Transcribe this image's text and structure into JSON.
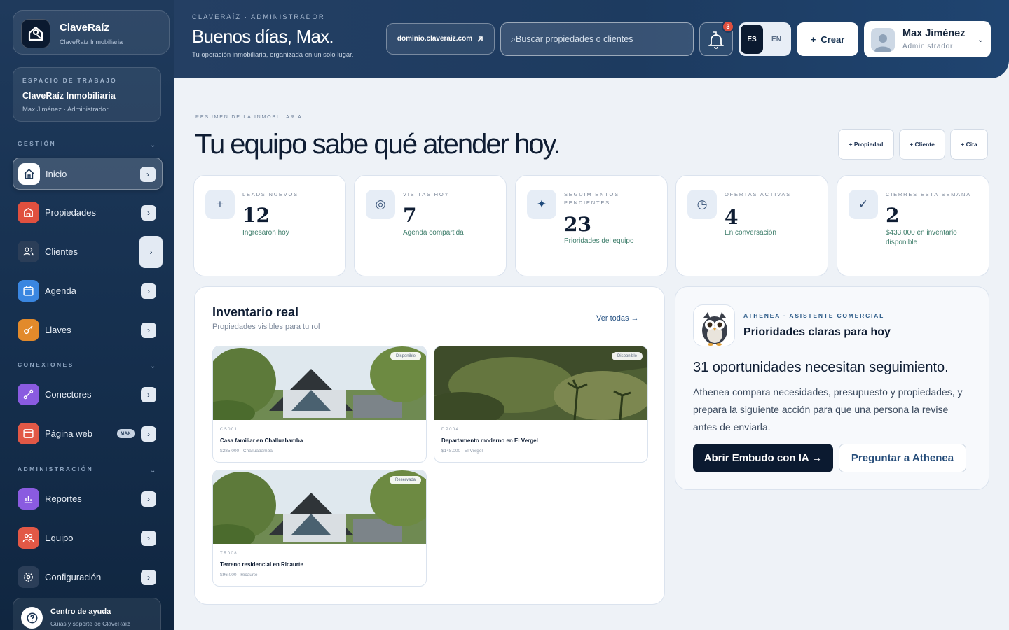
{
  "brand": {
    "name": "ClaveRaíz",
    "sub": "ClaveRaíz Inmobiliaria"
  },
  "workspace": {
    "label": "ESPACIO DE TRABAJO",
    "name": "ClaveRaíz Inmobiliaria",
    "user": "Max Jiménez · Administrador"
  },
  "sidebar": {
    "sections": [
      {
        "title": "GESTIÓN",
        "chevron": "⌄"
      },
      {
        "title": "CONEXIONES",
        "chevron": "⌄"
      },
      {
        "title": "ADMINISTRACIÓN",
        "chevron": "⌄"
      }
    ],
    "items": [
      {
        "label": "Inicio",
        "icon": "home-icon",
        "color": "#ffffff",
        "arrow": "›"
      },
      {
        "label": "Propiedades",
        "icon": "building-icon",
        "color": "#e0503f",
        "arrow": "›"
      },
      {
        "label": "Clientes",
        "icon": "users-icon",
        "color": "#2b3e58",
        "arrow": "›"
      },
      {
        "label": "Agenda",
        "icon": "calendar-icon",
        "color": "#3a86e0",
        "arrow": "›"
      },
      {
        "label": "Llaves",
        "icon": "key-icon",
        "color": "#e28a2b",
        "arrow": "›"
      },
      {
        "label": "Conectores",
        "icon": "plug-icon",
        "color": "#8a5be0",
        "arrow": "›"
      },
      {
        "label": "Página web",
        "icon": "browser-icon",
        "color": "#e25846",
        "arrow": "›",
        "badge": "MAX"
      },
      {
        "label": "Reportes",
        "icon": "chart-icon",
        "color": "#8a5be0",
        "arrow": "›"
      },
      {
        "label": "Equipo",
        "icon": "team-icon",
        "color": "#e25846",
        "arrow": "›"
      },
      {
        "label": "Configuración",
        "icon": "gear-icon",
        "color": "#2b3e58",
        "arrow": "›"
      }
    ],
    "help": {
      "title": "Centro de ayuda",
      "sub": "Guías y soporte de ClaveRaíz",
      "icon": "help-icon"
    }
  },
  "header": {
    "eyebrow": "CLAVERAÍZ · ADMINISTRADOR",
    "title": "Buenos días, Max.",
    "sub": "Tu operación inmobiliaria, organizada en un solo lugar.",
    "domain": "dominio.claveraiz.com",
    "search_placeholder": "⌕Buscar propiedades o clientes",
    "notifications": "3",
    "lang_es": "ES",
    "lang_en": "EN",
    "create_icon": "+",
    "create": "Crear",
    "user_name": "Max Jiménez",
    "user_role": "Administrador",
    "user_chevron": "⌄"
  },
  "main": {
    "eyebrow": "RESUMEN DE LA INMOBILIARIA",
    "headline": "Tu equipo sabe qué atender hoy.",
    "quick_actions": [
      "+ Propiedad",
      "+ Cliente",
      "+ Cita"
    ]
  },
  "kpis": [
    {
      "icon": "+",
      "icon_name": "plus-icon",
      "label": "LEADS NUEVOS",
      "value": "12",
      "sub": "Ingresaron hoy"
    },
    {
      "icon": "◎",
      "icon_name": "target-icon",
      "label": "VISITAS HOY",
      "value": "7",
      "sub": "Agenda compartida"
    },
    {
      "icon": "✦",
      "icon_name": "sparkle-icon",
      "label": "SEGUIMIENTOS PENDIENTES",
      "value": "23",
      "sub": "Prioridades del equipo"
    },
    {
      "icon": "◷",
      "icon_name": "clock-icon",
      "label": "OFERTAS ACTIVAS",
      "value": "4",
      "sub": "En conversación"
    },
    {
      "icon": "✓",
      "icon_name": "check-icon",
      "label": "CIERRES ESTA SEMANA",
      "value": "2",
      "sub": "$433.000 en inventario disponible"
    }
  ],
  "inventory": {
    "title": "Inventario real",
    "sub": "Propiedades visibles para tu rol",
    "link": "Ver todas →",
    "cards": [
      {
        "badge": "Disponible",
        "code": "CS001",
        "title": "Casa familiar en Challuabamba",
        "meta": "$285.000 · Challuabamba"
      },
      {
        "badge": "Disponible",
        "code": "DP004",
        "title": "Departamento moderno en El Vergel",
        "meta": "$148.000 · El Vergel"
      },
      {
        "badge": "Reservada",
        "code": "TR008",
        "title": "Terreno residencial en Ricaurte",
        "meta": "$96.000 · Ricaurte"
      }
    ]
  },
  "athena": {
    "eyebrow": "ATHENEA · ASISTENTE COMERCIAL",
    "title": "Prioridades claras para hoy",
    "headline": "31 oportunidades necesitan seguimiento.",
    "body": "Athenea compara necesidades, presupuesto y propiedades, y prepara la siguiente acción para que una persona la revise antes de enviarla.",
    "primary": "Abrir Embudo con IA →",
    "secondary": "Preguntar a Athenea"
  }
}
